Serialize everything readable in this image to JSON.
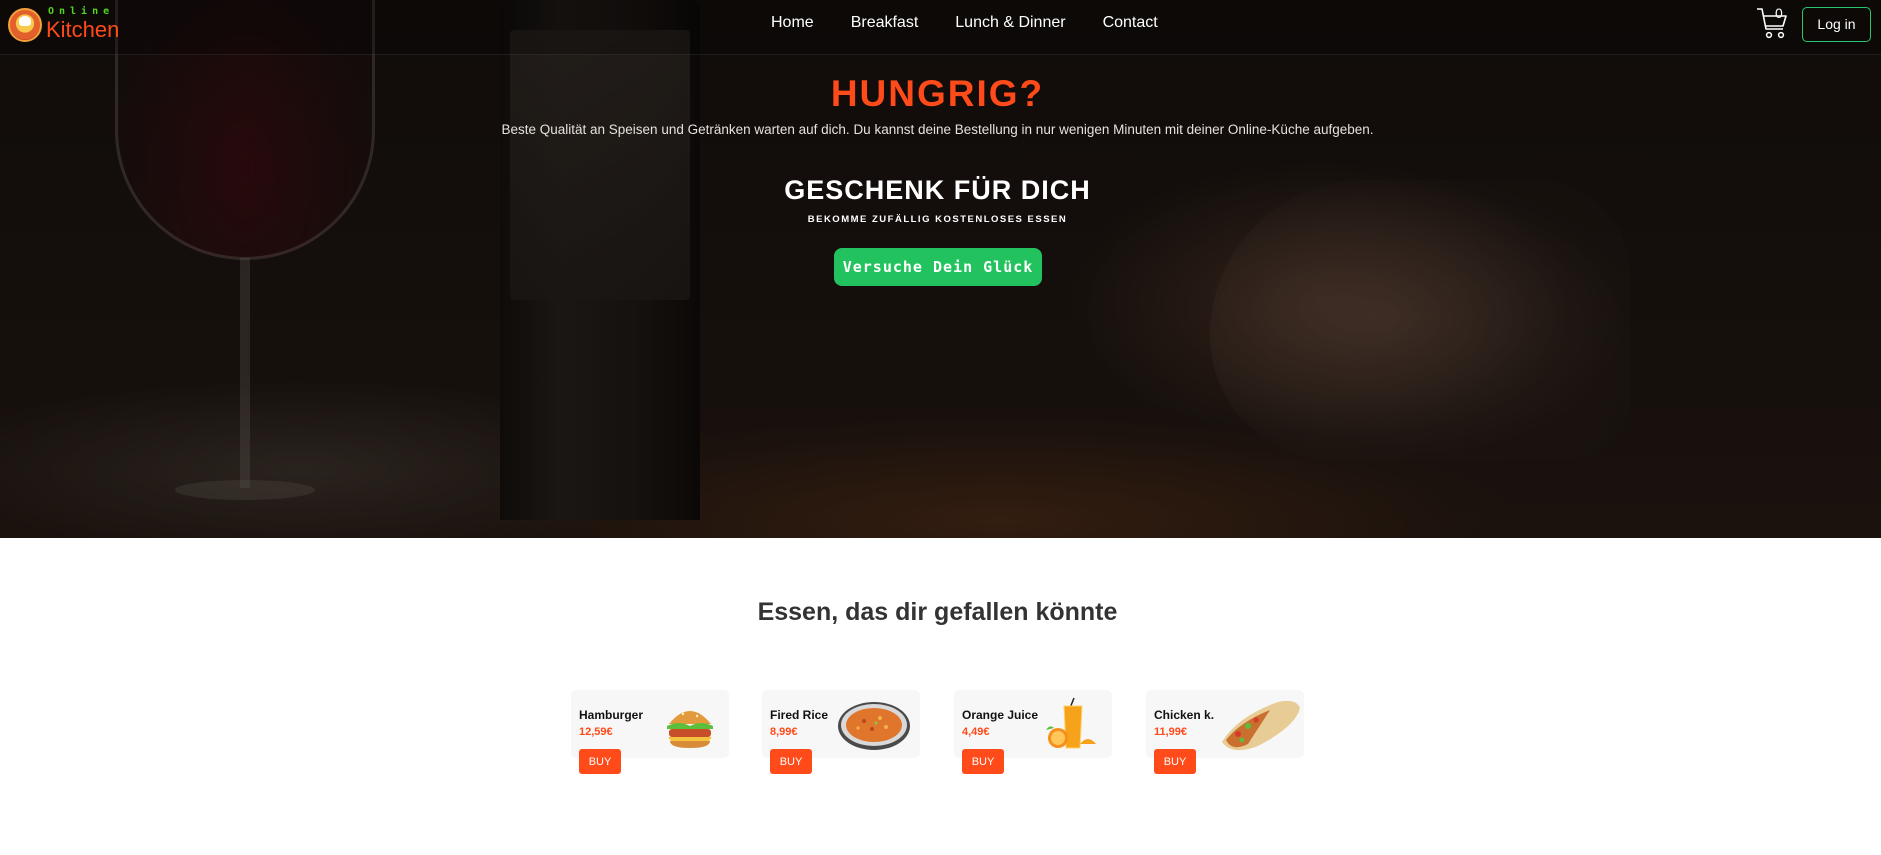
{
  "logo": {
    "top": "Online",
    "bottom": "Kitchen"
  },
  "nav": {
    "links": [
      "Home",
      "Breakfast",
      "Lunch & Dinner",
      "Contact"
    ]
  },
  "cart": {
    "count": "0",
    "icon": "shopping-cart-icon"
  },
  "login": {
    "label": "Log in"
  },
  "hero": {
    "title": "HUNGRIG?",
    "subtitle": "Beste Qualität an Speisen und Getränken warten auf dich. Du kannst deine Bestellung in nur wenigen Minuten mit deiner Online-Küche aufgeben.",
    "gift_title": "GESCHENK FÜR DICH",
    "gift_subtitle": "BEKOMME ZUFÄLLIG KOSTENLOSES ESSEN",
    "luck_button": "Versuche Dein Glück"
  },
  "section": {
    "title": "Essen, das dir gefallen könnte",
    "buy_label": "BUY",
    "items": [
      {
        "name": "Hamburger",
        "price": "12,59€",
        "image": "hamburger-image"
      },
      {
        "name": "Fired Rice",
        "price": "8,99€",
        "image": "fried-rice-image"
      },
      {
        "name": "Orange Juice",
        "price": "4,49€",
        "image": "orange-juice-image"
      },
      {
        "name": "Chicken k.",
        "price": "11,99€",
        "image": "chicken-wrap-image"
      }
    ]
  },
  "colors": {
    "accent": "#ff4a1a",
    "green": "#22c35e",
    "logo_green": "#4fd61d"
  }
}
